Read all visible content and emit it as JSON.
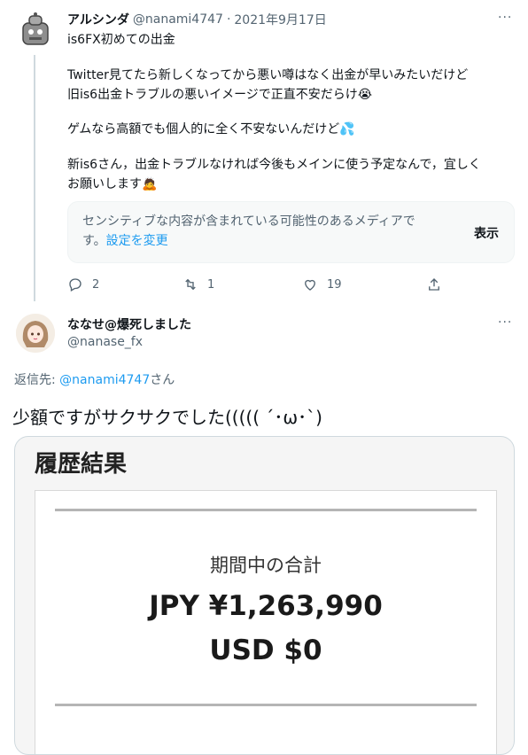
{
  "tweet1": {
    "display_name": "アルシンダ",
    "handle": "@nanami4747",
    "separator": "·",
    "date": "2021年9月17日",
    "more": "···",
    "line1": "is6FX初めての出金",
    "para1": "Twitter見てたら新しくなってから悪い噂はなく出金が早いみたいだけど\n旧is6出金トラブルの悪いイメージで正直不安だらけ😭",
    "para2": "ゲムなら高額でも個人的に全く不安ないんだけど💦",
    "para3": "新is6さん，出金トラブルなければ今後もメインに使う予定なんで，宜しく\nお願いします🙇",
    "sensitive_text": "センシティブな内容が含まれている可能性のあるメディアで",
    "sensitive_text2": "す。",
    "settings_link": "設定を変更",
    "show_label": "表示",
    "reply_count": "2",
    "retweet_count": "1",
    "like_count": "19"
  },
  "tweet2": {
    "display_name": "ななせ@爆死しました",
    "handle": "@nanase_fx",
    "more": "···",
    "reply_prefix": "返信先: ",
    "reply_handle": "@nanami4747",
    "reply_suffix": "さん",
    "text": "少額ですがサクサクでした((((( ´･ω･`)",
    "image": {
      "title": "履歴結果",
      "period_label": "期間中の合計",
      "jpy": "JPY ¥1,263,990",
      "usd": "USD $0"
    }
  },
  "icons": {
    "reply": "reply-icon",
    "retweet": "retweet-icon",
    "like": "heart-icon",
    "share": "share-icon"
  }
}
